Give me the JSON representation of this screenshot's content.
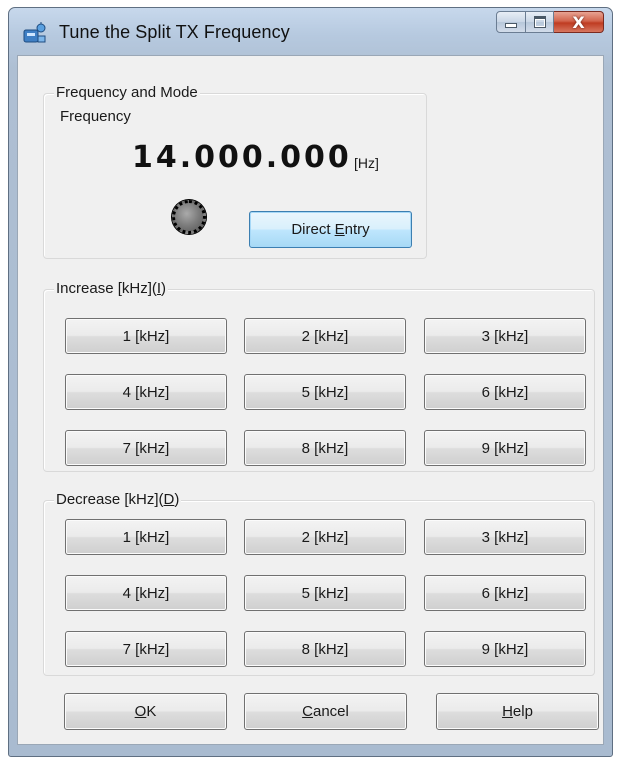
{
  "window": {
    "title": "Tune the Split TX Frequency",
    "close_glyph": "X"
  },
  "frequency_group": {
    "label": "Frequency and Mode",
    "sub_label": "Frequency",
    "value": "14.000.000",
    "unit": "[Hz]",
    "direct_entry": {
      "pre": "Direct ",
      "mnemonic": "E",
      "post": "ntry"
    }
  },
  "increase_group": {
    "label_pre": "Increase [kHz](",
    "label_mnemonic": "I",
    "label_post": ")",
    "buttons": [
      "1 [kHz]",
      "2 [kHz]",
      "3 [kHz]",
      "4 [kHz]",
      "5 [kHz]",
      "6 [kHz]",
      "7 [kHz]",
      "8 [kHz]",
      "9 [kHz]"
    ]
  },
  "decrease_group": {
    "label_pre": "Decrease [kHz](",
    "label_mnemonic": "D",
    "label_post": ")",
    "buttons": [
      "1 [kHz]",
      "2 [kHz]",
      "3 [kHz]",
      "4 [kHz]",
      "5 [kHz]",
      "6 [kHz]",
      "7 [kHz]",
      "8 [kHz]",
      "9 [kHz]"
    ]
  },
  "footer": {
    "ok": {
      "mnemonic": "O",
      "post": "K"
    },
    "cancel": {
      "mnemonic": "C",
      "post": "ancel"
    },
    "help": {
      "mnemonic": "H",
      "post": "elp"
    }
  },
  "icons": {
    "app": "antenna-app-icon",
    "knob": "tuning-knob-icon"
  },
  "colors": {
    "title_bar": "#b6c9df",
    "close_button": "#c8462c",
    "dialog_face": "#f0f0f0",
    "focus_button": "#bee6fd"
  }
}
